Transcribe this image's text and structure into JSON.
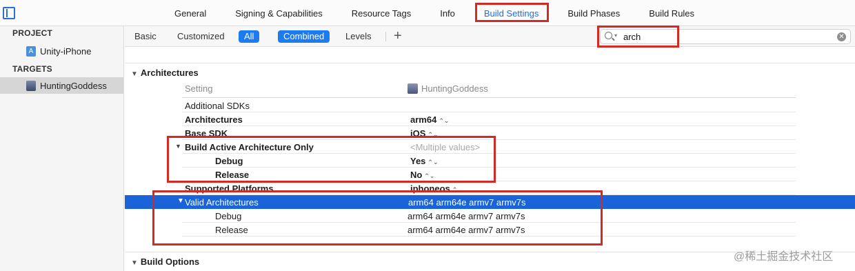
{
  "tabs": [
    "General",
    "Signing & Capabilities",
    "Resource Tags",
    "Info",
    "Build Settings",
    "Build Phases",
    "Build Rules"
  ],
  "active_tab": "Build Settings",
  "sidebar": {
    "project_header": "PROJECT",
    "project_item": "Unity-iPhone",
    "targets_header": "TARGETS",
    "target_item": "HuntingGoddess"
  },
  "filter": {
    "basic": "Basic",
    "customized": "Customized",
    "all": "All",
    "combined": "Combined",
    "levels": "Levels",
    "add": "+",
    "search_value": "arch"
  },
  "groups": {
    "architectures": "Architectures",
    "build_options": "Build Options"
  },
  "columns": {
    "setting": "Setting",
    "target": "HuntingGoddess"
  },
  "rows": {
    "additional_sdks": {
      "name": "Additional SDKs",
      "value": ""
    },
    "architectures": {
      "name": "Architectures",
      "value": "arm64"
    },
    "base_sdk": {
      "name": "Base SDK",
      "value": "iOS"
    },
    "active_arch": {
      "name": "Build Active Architecture Only",
      "value": "<Multiple values>"
    },
    "active_arch_debug": {
      "name": "Debug",
      "value": "Yes"
    },
    "active_arch_release": {
      "name": "Release",
      "value": "No"
    },
    "supported_platforms": {
      "name": "Supported Platforms",
      "value": "iphoneos"
    },
    "valid_arch": {
      "name": "Valid Architectures",
      "value": "arm64 arm64e armv7 armv7s"
    },
    "valid_arch_debug": {
      "name": "Debug",
      "value": "arm64 arm64e armv7 armv7s"
    },
    "valid_arch_release": {
      "name": "Release",
      "value": "arm64 arm64e armv7 armv7s"
    }
  },
  "watermark": "@稀土掘金技术社区",
  "colors": {
    "accent": "#1a7cf0",
    "selection": "#1a63d8",
    "highlight_box": "#d32a24"
  }
}
